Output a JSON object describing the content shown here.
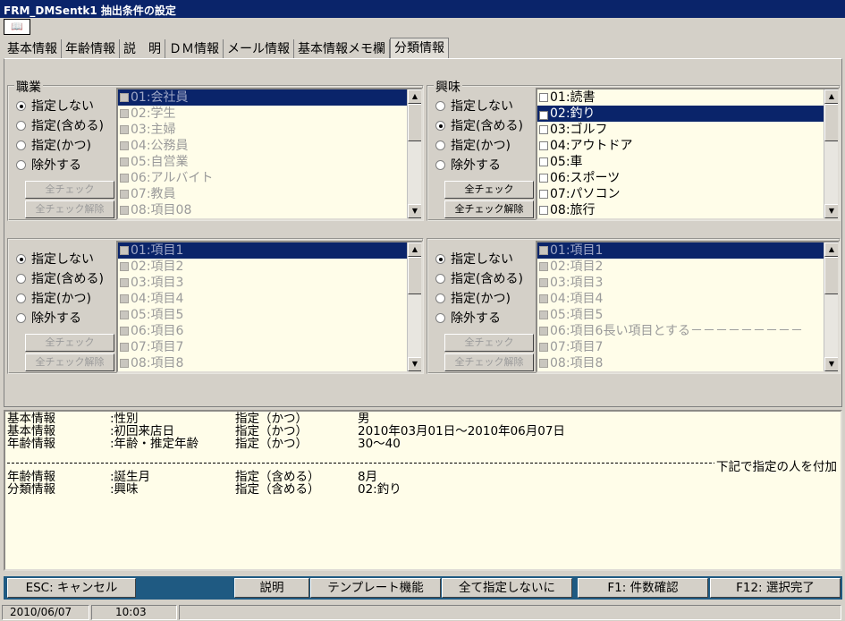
{
  "window": {
    "title": "FRM_DMSentk1 抽出条件の設定"
  },
  "toolbar": {
    "icon": "book-icon"
  },
  "tabs": [
    "基本情報",
    "年齢情報",
    "説　明",
    "ＤＭ情報",
    "メール情報",
    "基本情報メモ欄",
    "分類情報"
  ],
  "active_tab": 6,
  "radio_labels": [
    "指定しない",
    "指定(含める)",
    "指定(かつ)",
    "除外する"
  ],
  "btn": {
    "check_all": "全チェック",
    "uncheck_all": "全チェック解除"
  },
  "panels": [
    {
      "title": "職業",
      "selected_radio": 0,
      "enabled": false,
      "items": [
        "01:会社員",
        "02:学生",
        "03:主婦",
        "04:公務員",
        "05:自営業",
        "06:アルバイト",
        "07:教員",
        "08:項目08"
      ],
      "highlight": 0,
      "checked": []
    },
    {
      "title": "興味",
      "selected_radio": 1,
      "enabled": true,
      "items": [
        "01:読書",
        "02:釣り",
        "03:ゴルフ",
        "04:アウトドア",
        "05:車",
        "06:スポーツ",
        "07:パソコン",
        "08:旅行"
      ],
      "highlight": 1,
      "checked": [
        1
      ]
    },
    {
      "title": "",
      "selected_radio": 0,
      "enabled": false,
      "items": [
        "01:項目1",
        "02:項目2",
        "03:項目3",
        "04:項目4",
        "05:項目5",
        "06:項目6",
        "07:項目7",
        "08:項目8"
      ],
      "highlight": 0,
      "checked": []
    },
    {
      "title": "",
      "selected_radio": 0,
      "enabled": false,
      "items": [
        "01:項目1",
        "02:項目2",
        "03:項目3",
        "04:項目4",
        "05:項目5",
        "06:項目6長い項目とする－－－－－－－－－",
        "07:項目7",
        "08:項目8"
      ],
      "highlight": 0,
      "checked": []
    }
  ],
  "summary": {
    "rows_top": [
      [
        "基本情報",
        ":性別",
        "指定（かつ）",
        "男"
      ],
      [
        "基本情報",
        ":初回来店日",
        "指定（かつ）",
        "2010年03月01日～2010年06月07日"
      ],
      [
        "年齢情報",
        ":年齢・推定年齢",
        "指定（かつ）",
        "30～40"
      ]
    ],
    "divider_label": "下記で指定の人を付加",
    "rows_bottom": [
      [
        "年齢情報",
        ":誕生月",
        "指定（含める）",
        "8月"
      ],
      [
        "分類情報",
        ":興味",
        "指定（含める）",
        "02:釣り"
      ]
    ]
  },
  "fbuttons": {
    "esc": "ESC: キャンセル",
    "help": "説明",
    "template": "テンプレート機能",
    "reset_all": "全て指定しないに",
    "f1": "F1: 件数確認",
    "f12": "F12: 選択完了"
  },
  "status": {
    "date": "2010/06/07",
    "time": "10:03"
  }
}
